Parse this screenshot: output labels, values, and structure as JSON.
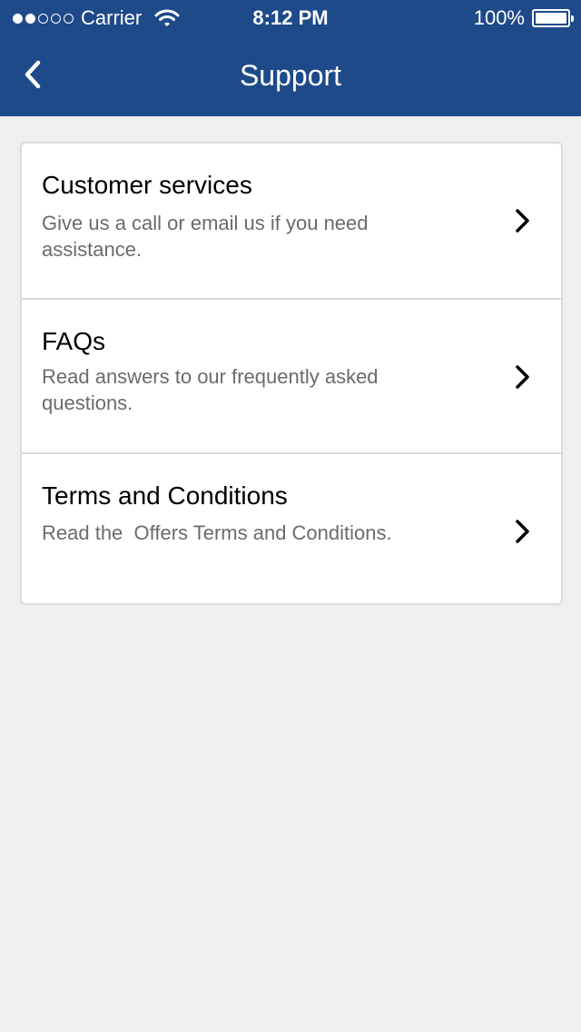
{
  "status_bar": {
    "carrier": "Carrier",
    "time": "8:12 PM",
    "battery": "100%",
    "signal_strength": 2,
    "signal_max": 5,
    "wifi_icon": "wifi-icon",
    "battery_icon": "battery-icon"
  },
  "nav": {
    "title": "Support",
    "back_icon": "chevron-left-icon"
  },
  "items": [
    {
      "title": "Customer services",
      "description": "Give us a call or email us if you need assistance.",
      "icon": "chevron-right-icon"
    },
    {
      "title": "FAQs",
      "description": "Read answers to our frequently asked questions.",
      "icon": "chevron-right-icon"
    },
    {
      "title": "Terms and Conditions",
      "description": "Read the  Offers Terms and Conditions.",
      "icon": "chevron-right-icon"
    }
  ],
  "colors": {
    "header_bg": "#1e4a8a",
    "page_bg": "#efefef",
    "card_bg": "#ffffff",
    "title_text": "#000000",
    "description_text": "#6b6b6b"
  }
}
